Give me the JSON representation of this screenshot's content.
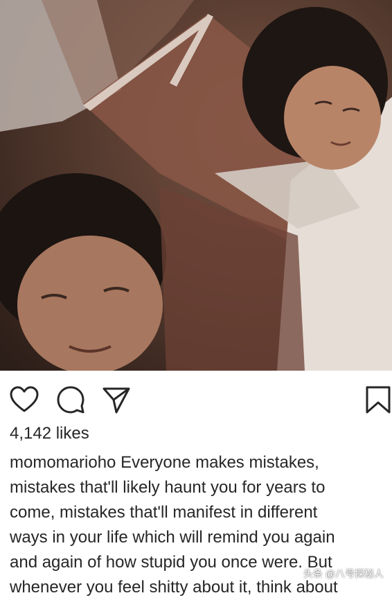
{
  "post": {
    "likes": "4,142 likes",
    "username": "momomarioho",
    "caption_lines": [
      "Everyone makes mistakes,",
      "mistakes that'll likely haunt you for years to",
      "come, mistakes that'll manifest in different",
      "ways in your life which will remind you again",
      "and again of how stupid you once were. But",
      "whenever you feel shitty about it, think about"
    ]
  },
  "actions": {
    "like_icon": "heart-icon",
    "comment_icon": "comment-icon",
    "share_icon": "send-icon",
    "save_icon": "bookmark-icon"
  },
  "watermark": {
    "text": "头条 @八号探秘人"
  },
  "colors": {
    "text": "#262626",
    "background": "#ffffff"
  }
}
